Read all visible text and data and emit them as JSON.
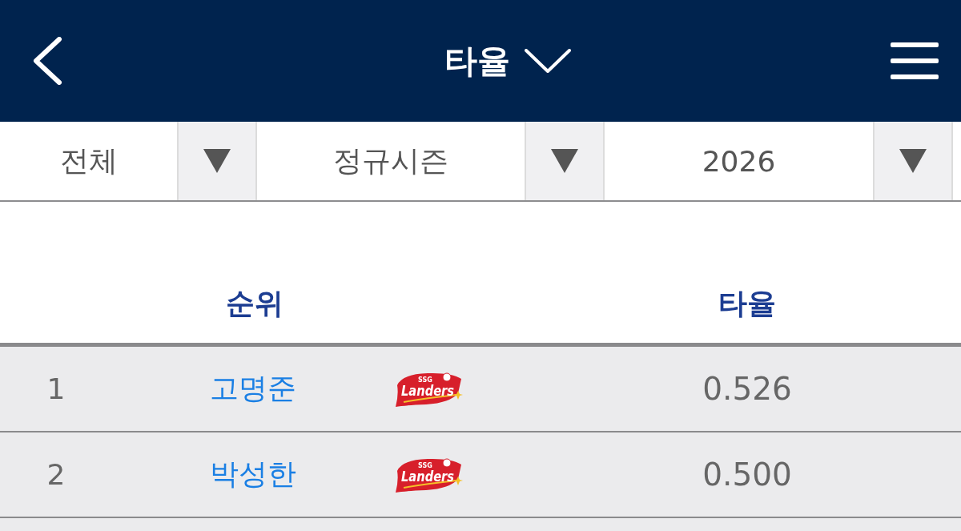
{
  "header": {
    "title": "타율"
  },
  "filters": [
    {
      "value": "전체"
    },
    {
      "value": "정규시즌"
    },
    {
      "value": "2026"
    }
  ],
  "table": {
    "columns": [
      "순위",
      "타율"
    ],
    "rows": [
      {
        "rank": "1",
        "name": "고명준",
        "logo_text": [
          "SSG",
          "Landers"
        ],
        "avg": "0.526"
      },
      {
        "rank": "2",
        "name": "박성한",
        "logo_text": [
          "SSG",
          "Landers"
        ],
        "avg": "0.500"
      }
    ]
  }
}
